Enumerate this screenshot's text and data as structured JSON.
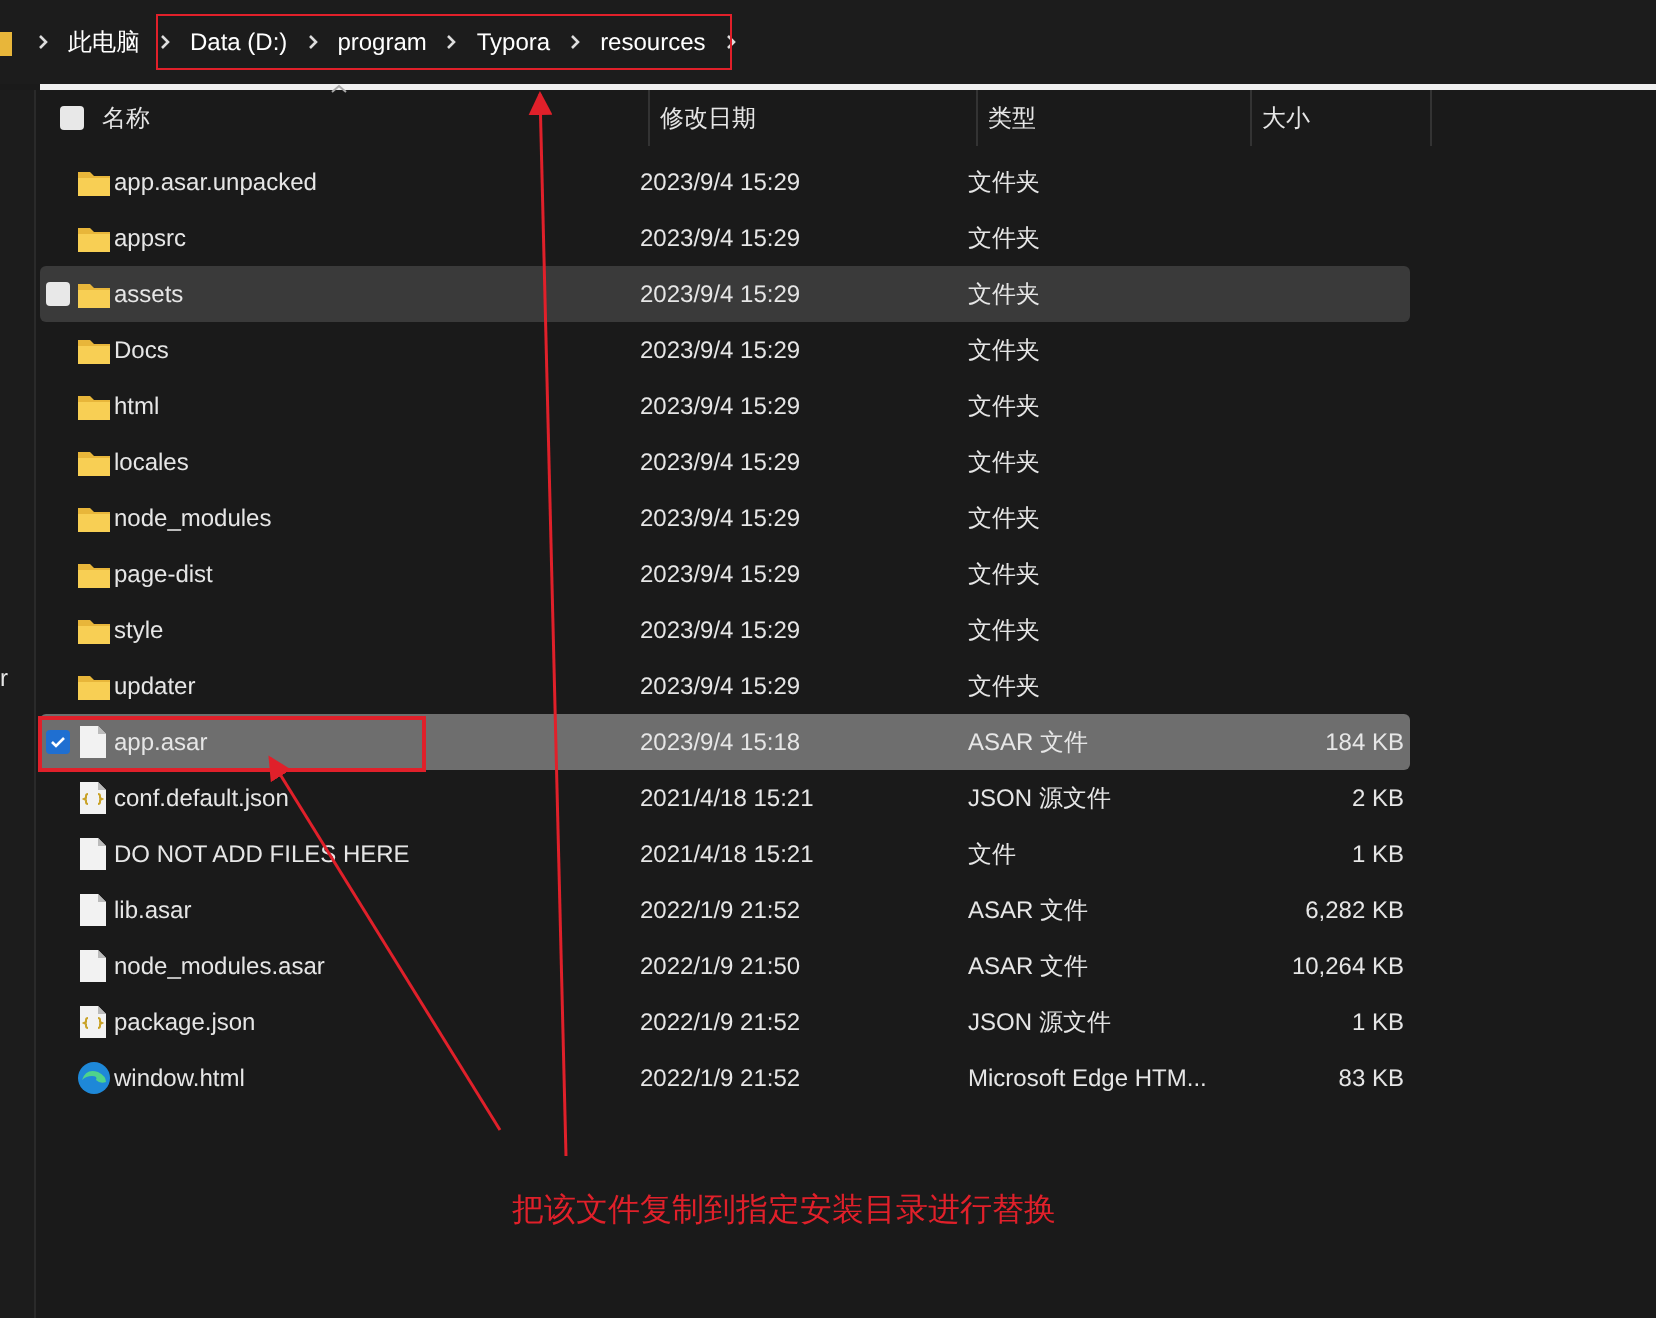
{
  "breadcrumb": [
    "此电脑",
    "Data (D:)",
    "program",
    "Typora",
    "resources"
  ],
  "sidebar": {
    "cut_label": "r"
  },
  "columns": [
    "名称",
    "修改日期",
    "类型",
    "大小"
  ],
  "select_all": {
    "checked": false
  },
  "rows": [
    {
      "kind": "folder",
      "name": "app.asar.unpacked",
      "date": "2023/9/4 15:29",
      "type": "文件夹",
      "hovered": false,
      "selected": false
    },
    {
      "kind": "folder",
      "name": "appsrc",
      "date": "2023/9/4 15:29",
      "type": "文件夹",
      "hovered": false,
      "selected": false
    },
    {
      "kind": "folder",
      "name": "assets",
      "date": "2023/9/4 15:29",
      "type": "文件夹",
      "hovered": true,
      "selected": false
    },
    {
      "kind": "folder",
      "name": "Docs",
      "date": "2023/9/4 15:29",
      "type": "文件夹",
      "hovered": false,
      "selected": false
    },
    {
      "kind": "folder",
      "name": "html",
      "date": "2023/9/4 15:29",
      "type": "文件夹",
      "hovered": false,
      "selected": false
    },
    {
      "kind": "folder",
      "name": "locales",
      "date": "2023/9/4 15:29",
      "type": "文件夹",
      "hovered": false,
      "selected": false
    },
    {
      "kind": "folder",
      "name": "node_modules",
      "date": "2023/9/4 15:29",
      "type": "文件夹",
      "hovered": false,
      "selected": false
    },
    {
      "kind": "folder",
      "name": "page-dist",
      "date": "2023/9/4 15:29",
      "type": "文件夹",
      "hovered": false,
      "selected": false
    },
    {
      "kind": "folder",
      "name": "style",
      "date": "2023/9/4 15:29",
      "type": "文件夹",
      "hovered": false,
      "selected": false
    },
    {
      "kind": "folder",
      "name": "updater",
      "date": "2023/9/4 15:29",
      "type": "文件夹",
      "hovered": false,
      "selected": false
    },
    {
      "kind": "file",
      "name": "app.asar",
      "date": "2023/9/4 15:18",
      "type": "ASAR 文件",
      "size": "184 KB",
      "hovered": false,
      "selected": true
    },
    {
      "kind": "json",
      "name": "conf.default.json",
      "date": "2021/4/18 15:21",
      "type": "JSON 源文件",
      "size": "2 KB",
      "hovered": false,
      "selected": false
    },
    {
      "kind": "file",
      "name": "DO NOT ADD FILES HERE",
      "date": "2021/4/18 15:21",
      "type": "文件",
      "size": "1 KB",
      "hovered": false,
      "selected": false
    },
    {
      "kind": "file",
      "name": "lib.asar",
      "date": "2022/1/9 21:52",
      "type": "ASAR 文件",
      "size": "6,282 KB",
      "hovered": false,
      "selected": false
    },
    {
      "kind": "file",
      "name": "node_modules.asar",
      "date": "2022/1/9 21:50",
      "type": "ASAR 文件",
      "size": "10,264 KB",
      "hovered": false,
      "selected": false
    },
    {
      "kind": "json",
      "name": "package.json",
      "date": "2022/1/9 21:52",
      "type": "JSON 源文件",
      "size": "1 KB",
      "hovered": false,
      "selected": false
    },
    {
      "kind": "edge",
      "name": "window.html",
      "date": "2022/1/9 21:52",
      "type": "Microsoft Edge HTM...",
      "size": "83 KB",
      "hovered": false,
      "selected": false
    }
  ],
  "annotation": {
    "caption": "把该文件复制到指定安装目录进行替换"
  }
}
